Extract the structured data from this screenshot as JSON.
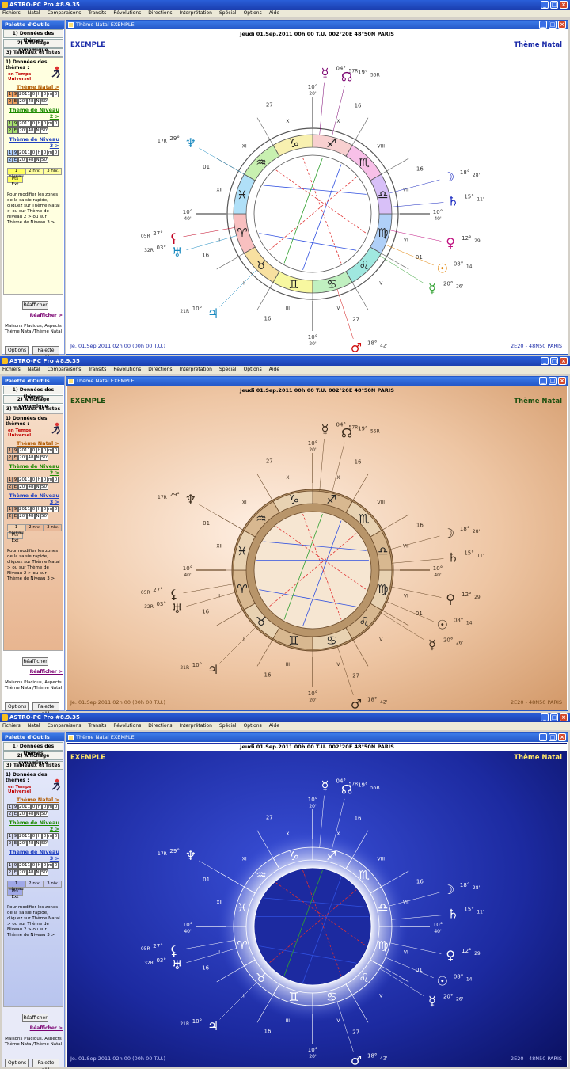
{
  "app": {
    "title": "ASTRO-PC Pro #8.9.35"
  },
  "menu": [
    "Fichiers",
    "Natal",
    "Comparaisons",
    "Transits",
    "Révolutions",
    "Directions",
    "Interprétation",
    "Spécial",
    "Options",
    "Aide"
  ],
  "palette": {
    "title": "Palette d'Outils",
    "buttons": [
      "1) Données des thèmes",
      "2) Affichage dynamique",
      "3) Tableaux et listes"
    ],
    "panel_title": "1) Données des thèmes :",
    "time_mode": "en Temps Universel",
    "sections": [
      "Thème Natal >",
      "Thème de Niveau 2 >",
      "Thème de Niveau 3 >"
    ],
    "row1": [
      "1",
      "9",
      "2011",
      "0",
      "h",
      "0",
      "m",
      "0"
    ],
    "row2": [
      "2",
      "E",
      "20'",
      "48",
      "N",
      "50'"
    ],
    "levels": [
      "1 niveau",
      "2 niv.",
      "3 niv."
    ],
    "pts_ext": "Pts Ext",
    "note": "Pour modifier les zones de la saisie rapide, cliquez sur Thème Natal > ou sur Thème de Niveau 2 > ou sur Thème de Niveau 3 >",
    "reafficher_btn": "Réafficher",
    "reafficher_link": "Réafficher >",
    "maisons": "Maisons Placidus, Aspects Thème Natal/Thème Natal",
    "options_btn": "Options",
    "palette_btn": "Palette n°1"
  },
  "window": {
    "title": "Thème Natal EXEMPLE",
    "header": "Jeudi 01.Sep.2011 00h 00 T.U.  002°20E 48°50N  PARIS",
    "name": "EXEMPLE",
    "chart_type": "Thème Natal",
    "footer_left": "Je. 01.Sep.2011 02h 00 (00h 00 T.U.)",
    "footer_right": "2E20 - 48N50  PARIS"
  },
  "chart": {
    "planets": [
      {
        "symbol": "☿",
        "deg": "04°",
        "min": "57R",
        "name": "mercury"
      },
      {
        "symbol": "☊",
        "deg": "19°",
        "min": "55R",
        "name": "node"
      },
      {
        "symbol": "♆",
        "deg": "29°",
        "min": "17R",
        "name": "neptune"
      },
      {
        "symbol": "☽",
        "deg": "18°",
        "min": "28'",
        "name": "moon"
      },
      {
        "symbol": "♄",
        "deg": "15°",
        "min": "11'",
        "name": "saturn"
      },
      {
        "symbol": "⚸",
        "deg": "27°",
        "min": "05R",
        "name": "lilith"
      },
      {
        "symbol": "♅",
        "deg": "03°",
        "min": "32R",
        "name": "uranus"
      },
      {
        "symbol": "♀",
        "deg": "12°",
        "min": "29'",
        "name": "venus"
      },
      {
        "symbol": "☉",
        "deg": "08°",
        "min": "14'",
        "name": "sun"
      },
      {
        "symbol": "☿",
        "deg": "20°",
        "min": "26'",
        "name": "mercury2"
      },
      {
        "symbol": "♃",
        "deg": "10°",
        "min": "21R",
        "name": "jupiter"
      },
      {
        "symbol": "♂",
        "deg": "18°",
        "min": "42'",
        "name": "mars"
      }
    ],
    "asc_mc": [
      {
        "deg": "10°",
        "min": "20'",
        "label": "MC"
      },
      {
        "deg": "10°",
        "min": "40'",
        "label": "AS"
      },
      {
        "deg": "10°",
        "min": "40'",
        "label": "DS"
      },
      {
        "deg": "10°",
        "min": "20'",
        "label": "FC"
      }
    ],
    "house_cusps": [
      "27",
      "01",
      "16",
      "16",
      "27",
      "01",
      "16",
      "16"
    ],
    "houses": [
      "I",
      "II",
      "III",
      "IV",
      "V",
      "VI",
      "VII",
      "VIII",
      "IX",
      "X",
      "XI",
      "XII"
    ],
    "signs": [
      "♈",
      "♉",
      "♊",
      "♋",
      "♌",
      "♍",
      "♎",
      "♏",
      "♐",
      "♑",
      "♒",
      "♓"
    ],
    "colors": {
      "s1": "#1b2ba8",
      "s2": "#7a4a1a",
      "s3": "#ffffff"
    }
  }
}
